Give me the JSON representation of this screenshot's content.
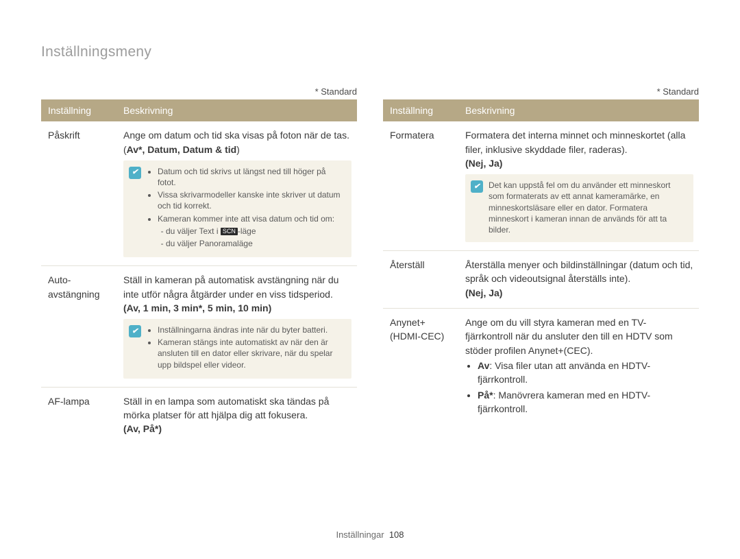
{
  "page_title": "Inställningsmeny",
  "standard_label": "* Standard",
  "header": {
    "setting": "Inställning",
    "description": "Beskrivning"
  },
  "left": {
    "rows": [
      {
        "label": "Påskrift",
        "intro": "Ange om datum och tid ska visas på foton när de tas. (",
        "options": "Av*, Datum, Datum & tid",
        "intro_close": ")",
        "note_items": [
          "Datum och tid skrivs ut längst ned till höger på fotot.",
          "Vissa skrivarmodeller kanske inte skriver ut datum och tid korrekt.",
          "Kameran kommer inte att visa datum och tid om:"
        ],
        "note_sub": [
          "du väljer Text i ",
          "du väljer Panoramaläge"
        ],
        "note_sub_mode": "-läge"
      },
      {
        "label": "Auto-avstängning",
        "intro": "Ställ in kameran på automatisk avstängning när du inte utför några åtgärder under en viss tidsperiod.",
        "options_line": "(Av, 1 min, 3 min*, 5 min, 10 min)",
        "note_items": [
          "Inställningarna ändras inte när du byter batteri.",
          "Kameran stängs inte automatiskt av när den är ansluten till en dator eller skrivare, när du spelar upp bildspel eller videor."
        ]
      },
      {
        "label": "AF-lampa",
        "intro": "Ställ in en lampa som automatiskt ska tändas på mörka platser för att hjälpa dig att fokusera.",
        "options_line": "(Av, På*)"
      }
    ]
  },
  "right": {
    "rows": [
      {
        "label": "Formatera",
        "intro": "Formatera det interna minnet och minneskortet (alla filer, inklusive skyddade filer, raderas).",
        "options_line": "(Nej, Ja)",
        "note_single": "Det kan uppstå fel om du använder ett minneskort som formaterats av ett annat kameramärke, en minneskortsläsare eller en dator. Formatera minneskort i kameran innan de används för att ta bilder."
      },
      {
        "label": "Återställ",
        "intro": "Återställa menyer och bildinställningar (datum och tid, språk och videoutsignal återställs inte).",
        "options_line": "(Nej, Ja)"
      },
      {
        "label": "Anynet+ (HDMI-CEC)",
        "intro": "Ange om du vill styra kameran med en TV-fjärrkontroll när du ansluter den till en HDTV som stöder profilen Anynet+(CEC).",
        "bullets": [
          {
            "opt": "Av",
            "text": ": Visa filer utan att använda en HDTV-fjärrkontroll."
          },
          {
            "opt": "På*",
            "text": ": Manövrera kameran med en HDTV-fjärrkontroll."
          }
        ]
      }
    ]
  },
  "footer": {
    "section": "Inställningar",
    "page": "108"
  }
}
